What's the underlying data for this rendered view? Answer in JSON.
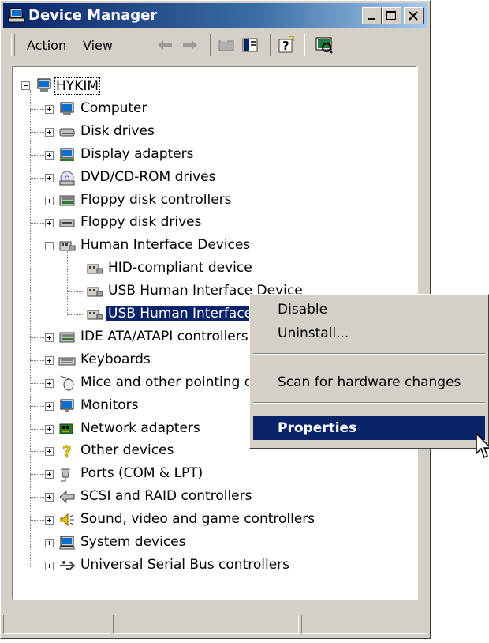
{
  "window": {
    "title": "Device Manager"
  },
  "menu": {
    "action": "Action",
    "view": "View"
  },
  "tree": {
    "root": "HYKIM",
    "items": [
      {
        "label": "Computer",
        "icon": "computer-icon"
      },
      {
        "label": "Disk drives",
        "icon": "disk-drive-icon"
      },
      {
        "label": "Display adapters",
        "icon": "display-adapter-icon"
      },
      {
        "label": "DVD/CD-ROM drives",
        "icon": "dvd-drive-icon"
      },
      {
        "label": "Floppy disk controllers",
        "icon": "floppy-controller-icon"
      },
      {
        "label": "Floppy disk drives",
        "icon": "floppy-drive-icon"
      },
      {
        "label": "Human Interface Devices",
        "icon": "hid-icon",
        "children": [
          {
            "label": "HID-compliant device",
            "icon": "hid-icon"
          },
          {
            "label": "USB Human Interface Device",
            "icon": "hid-icon"
          },
          {
            "label": "USB Human Interface Device",
            "icon": "hid-icon",
            "selected": true
          }
        ]
      },
      {
        "label": "IDE ATA/ATAPI controllers",
        "icon": "ide-controller-icon"
      },
      {
        "label": "Keyboards",
        "icon": "keyboard-icon"
      },
      {
        "label": "Mice and other pointing devices",
        "icon": "mouse-icon"
      },
      {
        "label": "Monitors",
        "icon": "monitor-icon"
      },
      {
        "label": "Network adapters",
        "icon": "network-adapter-icon"
      },
      {
        "label": "Other devices",
        "icon": "question-mark-icon"
      },
      {
        "label": "Ports (COM & LPT)",
        "icon": "port-icon"
      },
      {
        "label": "SCSI and RAID controllers",
        "icon": "scsi-icon"
      },
      {
        "label": "Sound, video and game controllers",
        "icon": "sound-icon"
      },
      {
        "label": "System devices",
        "icon": "system-device-icon"
      },
      {
        "label": "Universal Serial Bus controllers",
        "icon": "usb-icon"
      }
    ]
  },
  "context_menu": {
    "items": [
      {
        "label": "Disable"
      },
      {
        "label": "Uninstall..."
      },
      {
        "label": "Scan for hardware changes"
      },
      {
        "label": "Properties",
        "active": true
      }
    ]
  },
  "colors": {
    "selection": "#0a246a",
    "face": "#d4d0c8",
    "title_start": "#0a246a",
    "title_end": "#a6caf0"
  }
}
